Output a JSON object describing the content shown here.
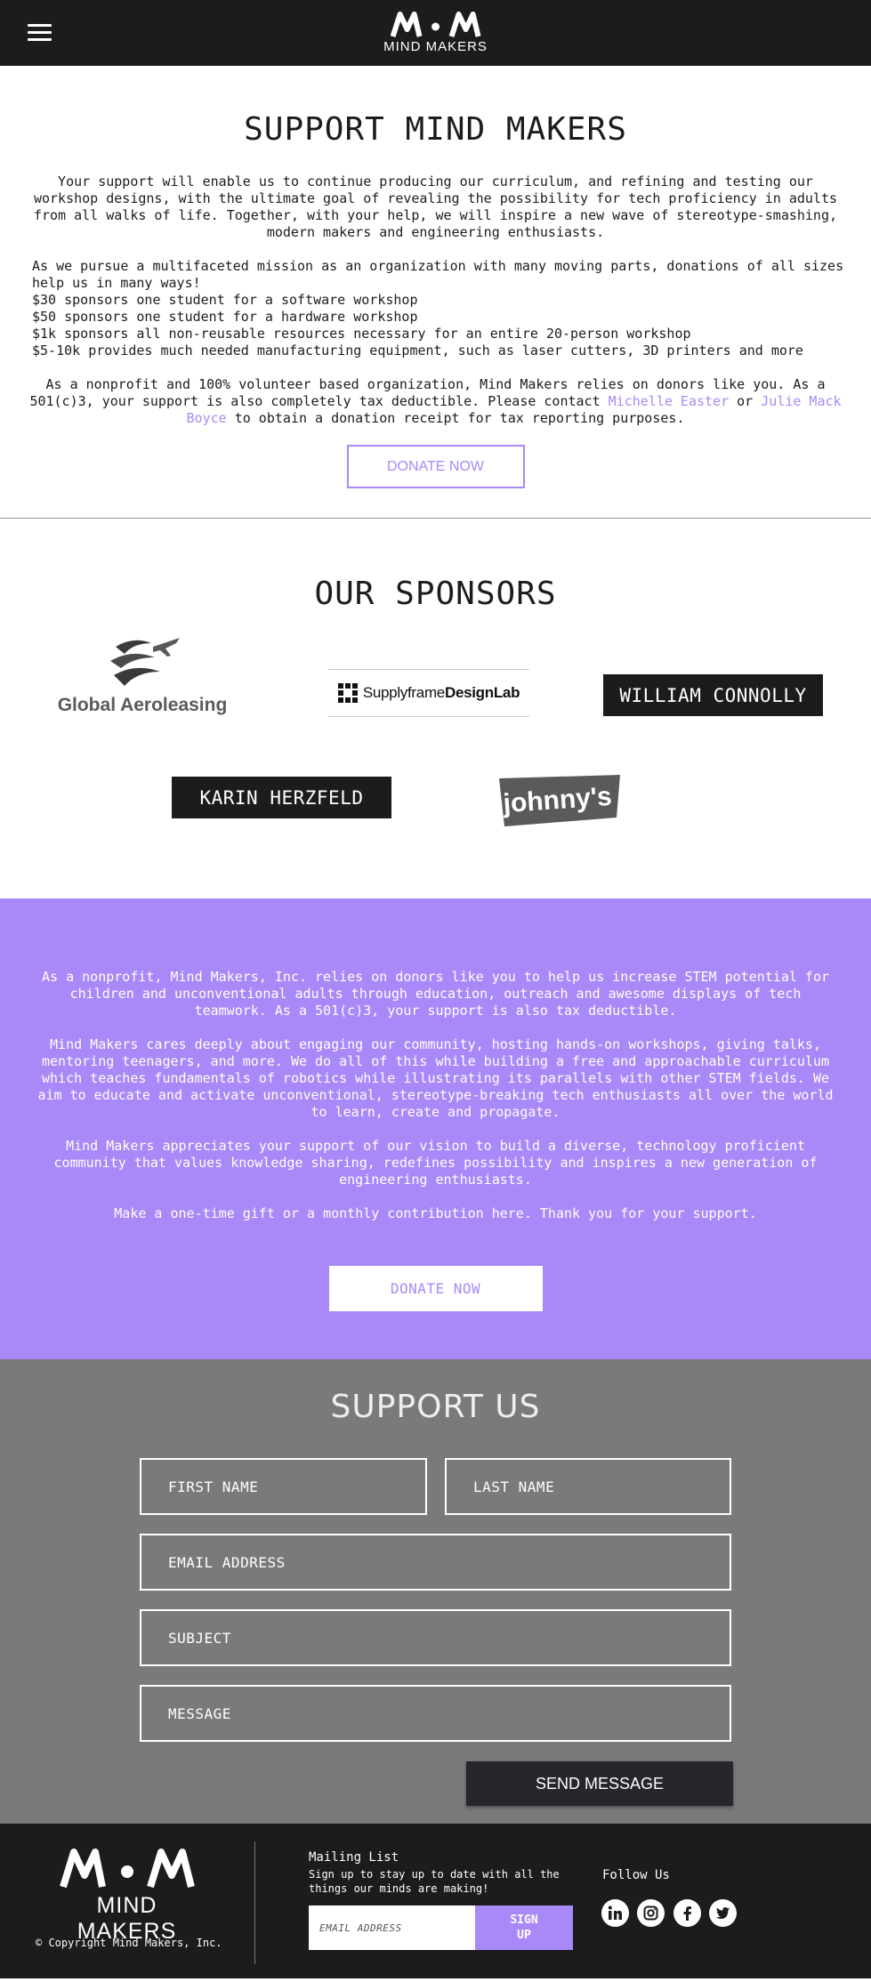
{
  "header": {
    "logo_text": "MIND MAKERS"
  },
  "support": {
    "title": "SUPPORT MIND MAKERS",
    "p1": "Your support will enable us to continue producing our curriculum, and refining and testing our workshop designs, with the ultimate goal of revealing the possibility for tech proficiency in adults from all walks of life. Together, with your help, we will inspire a new wave of stereotype-smashing, modern makers and engineering enthusiasts.",
    "p2_intro": "As we pursue a multifaceted mission as an organization with many moving parts, donations of all sizes help us in many ways!",
    "tiers": [
      "$30 sponsors one student for a software workshop",
      "$50 sponsors one student for a hardware workshop",
      "$1k sponsors all non-reusable resources necessary for an entire 20-person workshop",
      "$5-10k provides much needed manufacturing equipment, such as laser cutters, 3D printers and more"
    ],
    "p3_a": "As a nonprofit and 100% volunteer based organization, Mind Makers relies on donors like you. As a 501(c)3, your support is also completely tax deductible. Please contact ",
    "contact1": "Michelle Easter",
    "p3_or": " or ",
    "contact2": "Julie Mack Boyce",
    "p3_b": " to obtain a donation receipt for tax reporting purposes.",
    "donate_label": "DONATE NOW"
  },
  "sponsors": {
    "title": "OUR SPONSORS",
    "global": "Global Aeroleasing",
    "supply_a": "Supplyframe",
    "supply_b": "DesignLab",
    "william": "WILLIAM CONNOLLY",
    "karin": "KARIN HERZFELD",
    "johnnys": "johnny's"
  },
  "purple": {
    "p1": "As a nonprofit, Mind Makers, Inc. relies on donors like you to help us increase STEM potential for children and unconventional adults through education, outreach and awesome displays of tech teamwork. As a 501(c)3, your support is also tax deductible.",
    "p2": "Mind Makers cares deeply about engaging our community, hosting hands-on workshops, giving talks, mentoring teenagers, and more. We do all of this while building a free and approachable curriculum which teaches fundamentals of robotics while illustrating its parallels with other STEM fields. We aim to educate and activate unconventional, stereotype-breaking tech enthusiasts all over the world to learn, create and propagate.",
    "p3": "Mind Makers appreciates your support of our vision to build a diverse, technology proficient community that values knowledge sharing, redefines possibility and inspires a new generation of engineering enthusiasts.",
    "p4": "Make a one-time gift or a monthly contribution here. Thank you for your support.",
    "donate_label": "DONATE NOW"
  },
  "form": {
    "title": "SUPPORT US",
    "first": "FIRST NAME",
    "last": "LAST NAME",
    "email": "EMAIL ADDRESS",
    "subject": "SUBJECT",
    "message": "MESSAGE",
    "send": "SEND MESSAGE"
  },
  "footer": {
    "logo_text": "MIND MAKERS",
    "copyright": "© Copyright Mind Makers, Inc.",
    "mailing_title": "Mailing List",
    "mailing_desc": "Sign up to stay up to date with all the things our minds are making!",
    "email_placeholder": "EMAIL ADDRESS",
    "signup": "SIGN UP",
    "follow": "Follow Us",
    "social_icons": [
      "linkedin-icon",
      "instagram-icon",
      "facebook-icon",
      "twitter-icon"
    ]
  },
  "colors": {
    "accent": "#a989f8",
    "dark": "#1c1c1e",
    "gray": "#7a7a7a"
  }
}
